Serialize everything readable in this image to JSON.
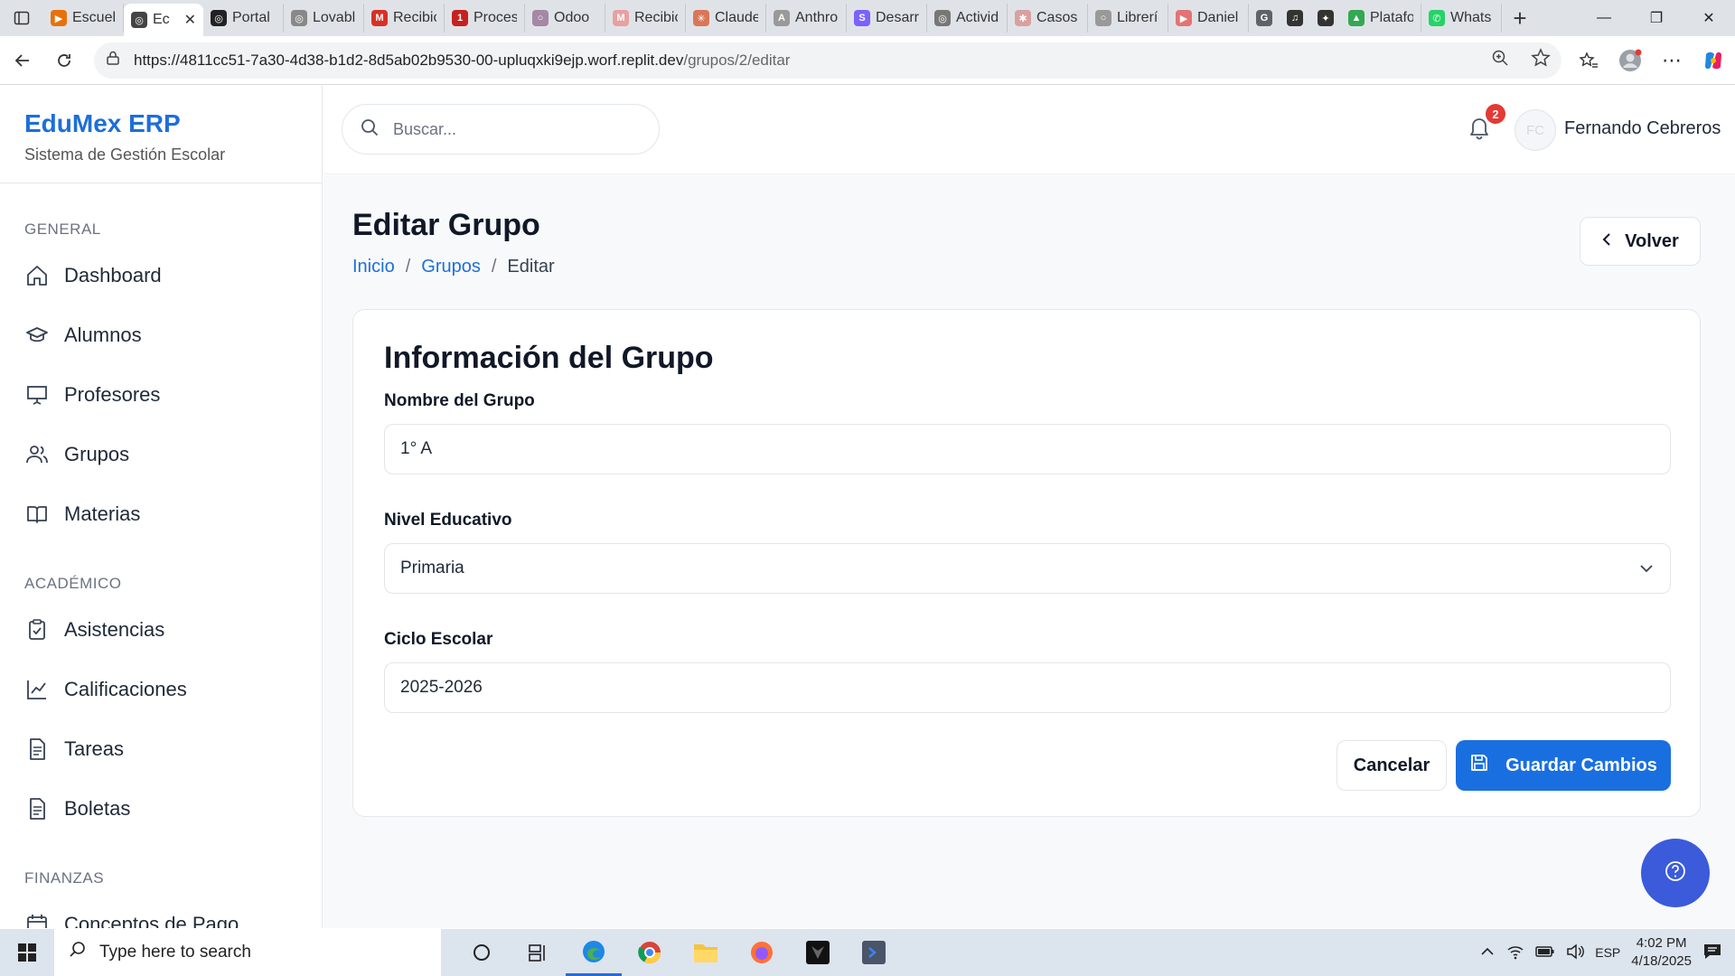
{
  "browser": {
    "tabs": [
      {
        "title": "Escuela",
        "fav_color": "#e8710a",
        "fav_glyph": "▶"
      },
      {
        "title": "Ec",
        "fav_color": "#444444",
        "fav_glyph": "◎",
        "active": true
      },
      {
        "title": "Portal",
        "fav_color": "#222222",
        "fav_glyph": "◎"
      },
      {
        "title": "Lovabl",
        "fav_color": "#888888",
        "fav_glyph": "◎"
      },
      {
        "title": "Recibic",
        "fav_color": "#d93025",
        "fav_glyph": "M"
      },
      {
        "title": "Proces",
        "fav_color": "#c5221f",
        "fav_glyph": "1"
      },
      {
        "title": "Odoo",
        "fav_color": "#a587a6",
        "fav_glyph": "○"
      },
      {
        "title": "Recibic",
        "fav_color": "#e8a0a0",
        "fav_glyph": "M"
      },
      {
        "title": "Claude",
        "fav_color": "#d97757",
        "fav_glyph": "✳"
      },
      {
        "title": "Anthro",
        "fav_color": "#999999",
        "fav_glyph": "A"
      },
      {
        "title": "Desarr",
        "fav_color": "#7b61ff",
        "fav_glyph": "S"
      },
      {
        "title": "Activid",
        "fav_color": "#777777",
        "fav_glyph": "◎"
      },
      {
        "title": "Casos",
        "fav_color": "#d9a0a0",
        "fav_glyph": "✱"
      },
      {
        "title": "Librerí",
        "fav_color": "#999999",
        "fav_glyph": "○"
      },
      {
        "title": "Daniel",
        "fav_color": "#e57373",
        "fav_glyph": "▶"
      },
      {
        "title": "",
        "fav_color": "#5f6368",
        "fav_glyph": "G"
      },
      {
        "title": "",
        "fav_color": "#333333",
        "fav_glyph": "♫"
      },
      {
        "title": "",
        "fav_color": "#333333",
        "fav_glyph": "✦"
      },
      {
        "title": "Platafo",
        "fav_color": "#34a853",
        "fav_glyph": "▲"
      },
      {
        "title": "Whats",
        "fav_color": "#25d366",
        "fav_glyph": "✆"
      }
    ],
    "url_host": "https://4811cc51-7a30-4d38-b1d2-8d5ab02b9530-00-upluqxki9ejp.worf.replit.dev",
    "url_path": "/grupos/2/editar"
  },
  "sidebar": {
    "brand_name": "EduMex ERP",
    "brand_sub": "Sistema de Gestión Escolar",
    "sections": [
      {
        "label": "GENERAL",
        "items": [
          {
            "label": "Dashboard",
            "icon": "home-icon"
          },
          {
            "label": "Alumnos",
            "icon": "graduation-cap-icon"
          },
          {
            "label": "Profesores",
            "icon": "presentation-icon"
          },
          {
            "label": "Grupos",
            "icon": "users-icon"
          },
          {
            "label": "Materias",
            "icon": "book-icon"
          }
        ]
      },
      {
        "label": "ACADÉMICO",
        "items": [
          {
            "label": "Asistencias",
            "icon": "clipboard-check-icon"
          },
          {
            "label": "Calificaciones",
            "icon": "line-chart-icon"
          },
          {
            "label": "Tareas",
            "icon": "file-text-icon"
          },
          {
            "label": "Boletas",
            "icon": "file-text-icon"
          }
        ]
      },
      {
        "label": "FINANZAS",
        "items": [
          {
            "label": "Conceptos de Pago",
            "icon": "calendar-icon"
          }
        ]
      }
    ]
  },
  "header": {
    "search_placeholder": "Buscar...",
    "notifications_count": "2",
    "avatar_initials": "FC",
    "user_name": "Fernando Cebreros"
  },
  "page": {
    "title": "Editar Grupo",
    "breadcrumb": {
      "home": "Inicio",
      "section": "Grupos",
      "current": "Editar"
    },
    "back_label": "Volver"
  },
  "form": {
    "card_title": "Información del Grupo",
    "name_label": "Nombre del Grupo",
    "name_value": "1° A",
    "level_label": "Nivel Educativo",
    "level_value": "Primaria",
    "cycle_label": "Ciclo Escolar",
    "cycle_value": "2025-2026",
    "cancel_label": "Cancelar",
    "save_label": "Guardar Cambios"
  },
  "taskbar": {
    "search_placeholder": "Type here to search",
    "lang": "ESP",
    "time": "4:02 PM",
    "date": "4/18/2025"
  },
  "colors": {
    "accent": "#1d6fd8",
    "save_button": "#1a6fe0",
    "help_button": "#3b5bdb",
    "badge": "#e53935"
  }
}
